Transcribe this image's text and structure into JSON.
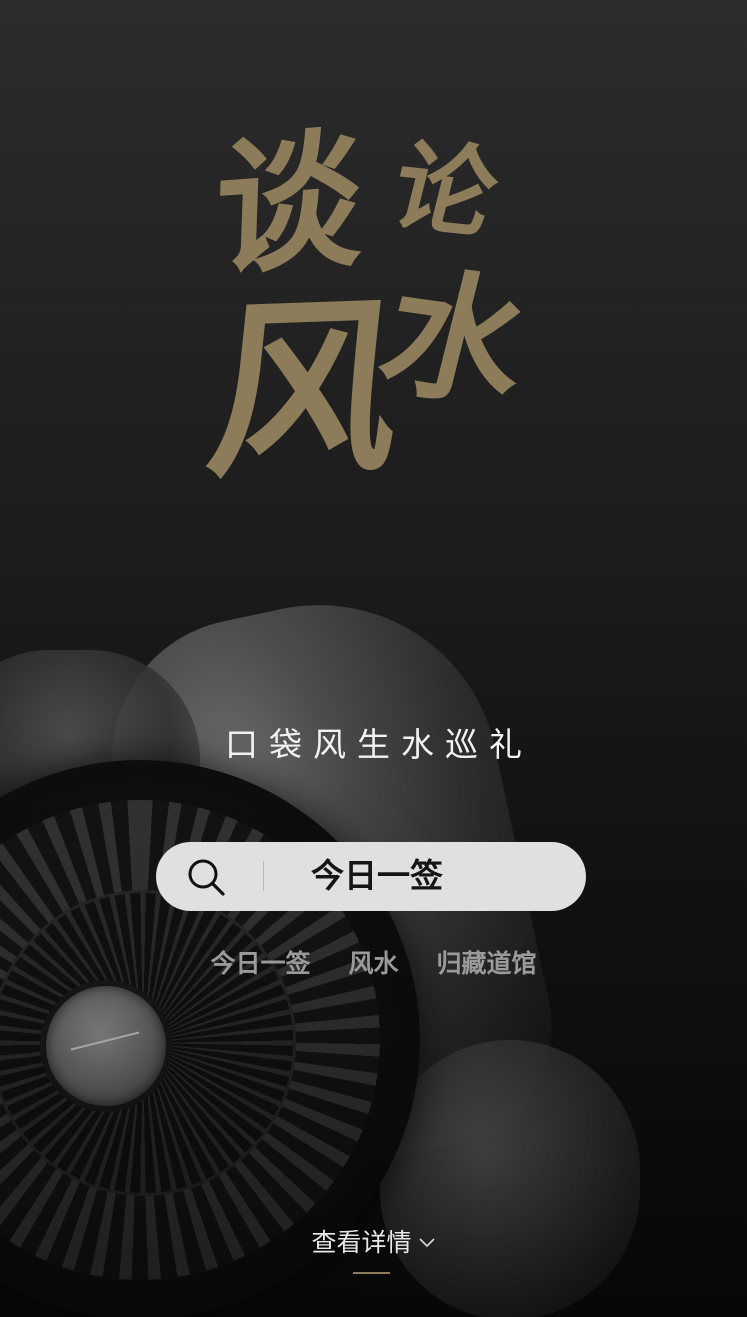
{
  "logo": {
    "chars": [
      "谈",
      "论",
      "风",
      "水"
    ],
    "color": "#8d7c5a"
  },
  "tagline": "口袋风生水巡礼",
  "search": {
    "value": "今日一签",
    "icon": "search-icon"
  },
  "quick_links": [
    {
      "label": "今日一签"
    },
    {
      "label": "风水"
    },
    {
      "label": "归藏道馆"
    }
  ],
  "details": {
    "label": "查看详情",
    "icon": "chevron-down-icon",
    "accent": "#8d7c5a"
  }
}
